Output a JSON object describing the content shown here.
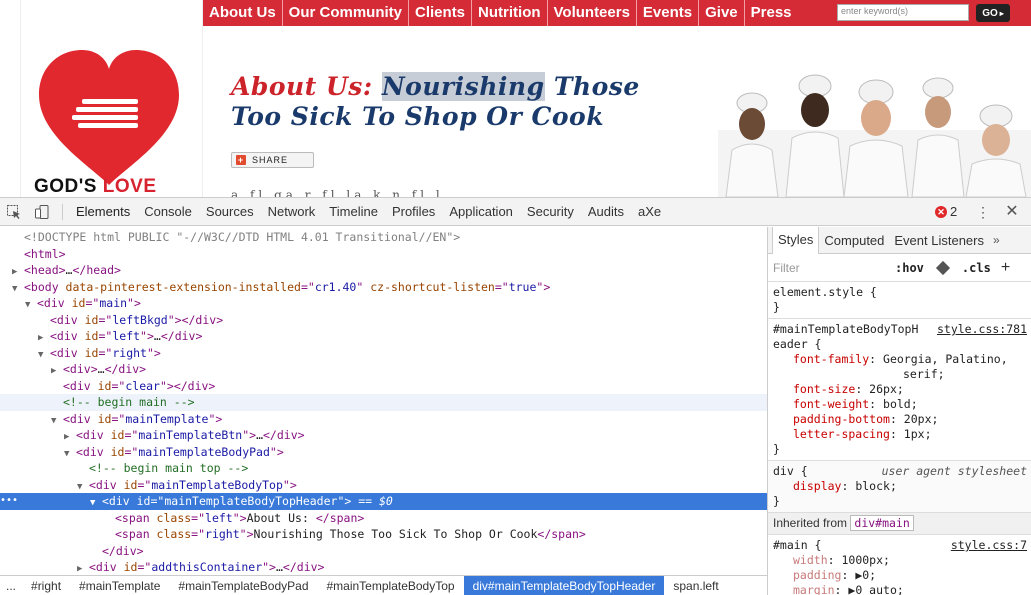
{
  "site": {
    "nav": [
      "About Us",
      "Our Community",
      "Clients",
      "Nutrition",
      "Volunteers",
      "Events",
      "Give",
      "Press"
    ],
    "search_placeholder": "enter keyword(s)",
    "go_label": "GO",
    "logo_text_a": "GOD'S",
    "logo_text_b": "LOVE",
    "headline_a": "About Us:",
    "headline_b": "Nourishing",
    "headline_c": "Those",
    "headline_line2": "Too Sick To Shop Or Cook",
    "share_label": "SHARE",
    "body_cut": "a  fl  ga  r     fl   la  k    n  fl   l"
  },
  "devtools": {
    "tabs": [
      "Elements",
      "Console",
      "Sources",
      "Network",
      "Timeline",
      "Profiles",
      "Application",
      "Security",
      "Audits",
      "aXe"
    ],
    "error_count": "2",
    "menu_icon": "⋮",
    "close_icon": "✕",
    "dom_lines": [
      {
        "indent": 0,
        "tri": "",
        "html": "<span class=\"dt\">&lt;!DOCTYPE html PUBLIC \"-//W3C//DTD HTML 4.01 Transitional//EN\"&gt;</span>"
      },
      {
        "indent": 0,
        "tri": "",
        "html": "<span class=\"tag\">&lt;html&gt;</span>"
      },
      {
        "indent": 0,
        "tri": "▶",
        "html": "<span class=\"tag\">&lt;head&gt;</span><span class=\"tx\">…</span><span class=\"tag\">&lt;/head&gt;</span>"
      },
      {
        "indent": 0,
        "tri": "▼",
        "html": "<span class=\"tag\">&lt;body </span><span class=\"an\">data-pinterest-extension-installed</span><span class=\"tag\">=\"</span><span class=\"av\">cr1.40</span><span class=\"tag\">\" </span><span class=\"an\">cz-shortcut-listen</span><span class=\"tag\">=\"</span><span class=\"av\">true</span><span class=\"tag\">\"&gt;</span>"
      },
      {
        "indent": 1,
        "tri": "▼",
        "html": "<span class=\"tag\">&lt;div </span><span class=\"an\">id</span><span class=\"tag\">=\"</span><span class=\"av\">main</span><span class=\"tag\">\"&gt;</span>"
      },
      {
        "indent": 2,
        "tri": "",
        "html": "<span class=\"tag\">&lt;div </span><span class=\"an\">id</span><span class=\"tag\">=\"</span><span class=\"av\">leftBkgd</span><span class=\"tag\">\"&gt;&lt;/div&gt;</span>"
      },
      {
        "indent": 2,
        "tri": "▶",
        "html": "<span class=\"tag\">&lt;div </span><span class=\"an\">id</span><span class=\"tag\">=\"</span><span class=\"av\">left</span><span class=\"tag\">\"&gt;</span><span class=\"tx\">…</span><span class=\"tag\">&lt;/div&gt;</span>"
      },
      {
        "indent": 2,
        "tri": "▼",
        "html": "<span class=\"tag\">&lt;div </span><span class=\"an\">id</span><span class=\"tag\">=\"</span><span class=\"av\">right</span><span class=\"tag\">\"&gt;</span>"
      },
      {
        "indent": 3,
        "tri": "▶",
        "html": "<span class=\"tag\">&lt;div&gt;</span><span class=\"tx\">…</span><span class=\"tag\">&lt;/div&gt;</span>"
      },
      {
        "indent": 3,
        "tri": "",
        "html": "<span class=\"tag\">&lt;div </span><span class=\"an\">id</span><span class=\"tag\">=\"</span><span class=\"av\">clear</span><span class=\"tag\">\"&gt;&lt;/div&gt;</span>"
      },
      {
        "indent": 3,
        "tri": "",
        "cls": "hover",
        "html": "<span class=\"cm\">&lt;!-- begin main --&gt;</span>"
      },
      {
        "indent": 3,
        "tri": "▼",
        "html": "<span class=\"tag\">&lt;div </span><span class=\"an\">id</span><span class=\"tag\">=\"</span><span class=\"av\">mainTemplate</span><span class=\"tag\">\"&gt;</span>"
      },
      {
        "indent": 4,
        "tri": "▶",
        "html": "<span class=\"tag\">&lt;div </span><span class=\"an\">id</span><span class=\"tag\">=\"</span><span class=\"av\">mainTemplateBtn</span><span class=\"tag\">\"&gt;</span><span class=\"tx\">…</span><span class=\"tag\">&lt;/div&gt;</span>"
      },
      {
        "indent": 4,
        "tri": "▼",
        "html": "<span class=\"tag\">&lt;div </span><span class=\"an\">id</span><span class=\"tag\">=\"</span><span class=\"av\">mainTemplateBodyPad</span><span class=\"tag\">\"&gt;</span>"
      },
      {
        "indent": 5,
        "tri": "",
        "html": "<span class=\"cm\">&lt;!-- begin main top --&gt;</span>"
      },
      {
        "indent": 5,
        "tri": "▼",
        "html": "<span class=\"tag\">&lt;div </span><span class=\"an\">id</span><span class=\"tag\">=\"</span><span class=\"av\">mainTemplateBodyTop</span><span class=\"tag\">\"&gt;</span>"
      },
      {
        "indent": 6,
        "tri": "▼",
        "cls": "sel",
        "html": "<span class=\"tag\">&lt;div </span><span class=\"an\">id</span><span class=\"tag\">=\"</span><span class=\"av\">mainTemplateBodyTopHeader</span><span class=\"tag\">\"&gt;</span> <span class=\"eq0\">== $0</span>"
      },
      {
        "indent": 7,
        "tri": "",
        "html": "<span class=\"tag\">&lt;span </span><span class=\"an\">class</span><span class=\"tag\">=\"</span><span class=\"av\">left</span><span class=\"tag\">\"&gt;</span><span class=\"tx\">About Us: </span><span class=\"tag\">&lt;/span&gt;</span>"
      },
      {
        "indent": 7,
        "tri": "",
        "html": "<span class=\"tag\">&lt;span </span><span class=\"an\">class</span><span class=\"tag\">=\"</span><span class=\"av\">right</span><span class=\"tag\">\"&gt;</span><span class=\"tx\">Nourishing Those Too Sick To Shop Or Cook</span><span class=\"tag\">&lt;/span&gt;</span>"
      },
      {
        "indent": 6,
        "tri": "",
        "html": "<span class=\"tag\">&lt;/div&gt;</span>"
      },
      {
        "indent": 5,
        "tri": "▶",
        "html": "<span class=\"tag\">&lt;div </span><span class=\"an\">id</span><span class=\"tag\">=\"</span><span class=\"av\">addthisContainer</span><span class=\"tag\">\"&gt;</span><span class=\"tx\">…</span><span class=\"tag\">&lt;/div&gt;</span>"
      }
    ],
    "breadcrumbs": [
      "...",
      "#right",
      "#mainTemplate",
      "#mainTemplateBodyPad",
      "#mainTemplateBodyTop",
      "div#mainTemplateBodyTopHeader",
      "span.left"
    ],
    "styles_tabs": [
      "Styles",
      "Computed",
      "Event Listeners"
    ],
    "styles_more": "»",
    "filter_placeholder": "Filter",
    "hov_label": ":hov",
    "cls_label": ".cls",
    "add_rule": "+",
    "element_style": "element.style {",
    "rule1_selector_a": "#mainTemplateBodyTopH",
    "rule1_selector_b": "eader {",
    "rule1_src": "style.css:781",
    "rule1_props": [
      {
        "n": "font-family",
        "v": "Georgia, Palatino,"
      },
      {
        "n": "",
        "v": "serif;"
      },
      {
        "n": "font-size",
        "v": "26px;"
      },
      {
        "n": "font-weight",
        "v": "bold;"
      },
      {
        "n": "padding-bottom",
        "v": "20px;"
      },
      {
        "n": "letter-spacing",
        "v": "1px;"
      }
    ],
    "rule2_selector": "div {",
    "rule2_src": "user agent stylesheet",
    "rule2_props": [
      {
        "n": "display",
        "v": "block;"
      }
    ],
    "inherited_label": "Inherited from",
    "inherited_pill": "div#main",
    "rule3_selector": "#main {",
    "rule3_src": "style.css:7",
    "rule3_props": [
      {
        "n": "width",
        "v": "1000px;"
      },
      {
        "n": "padding",
        "v": "▶0;"
      },
      {
        "n": "margin",
        "v": "▶0 auto;"
      }
    ],
    "close_brace": "}"
  }
}
